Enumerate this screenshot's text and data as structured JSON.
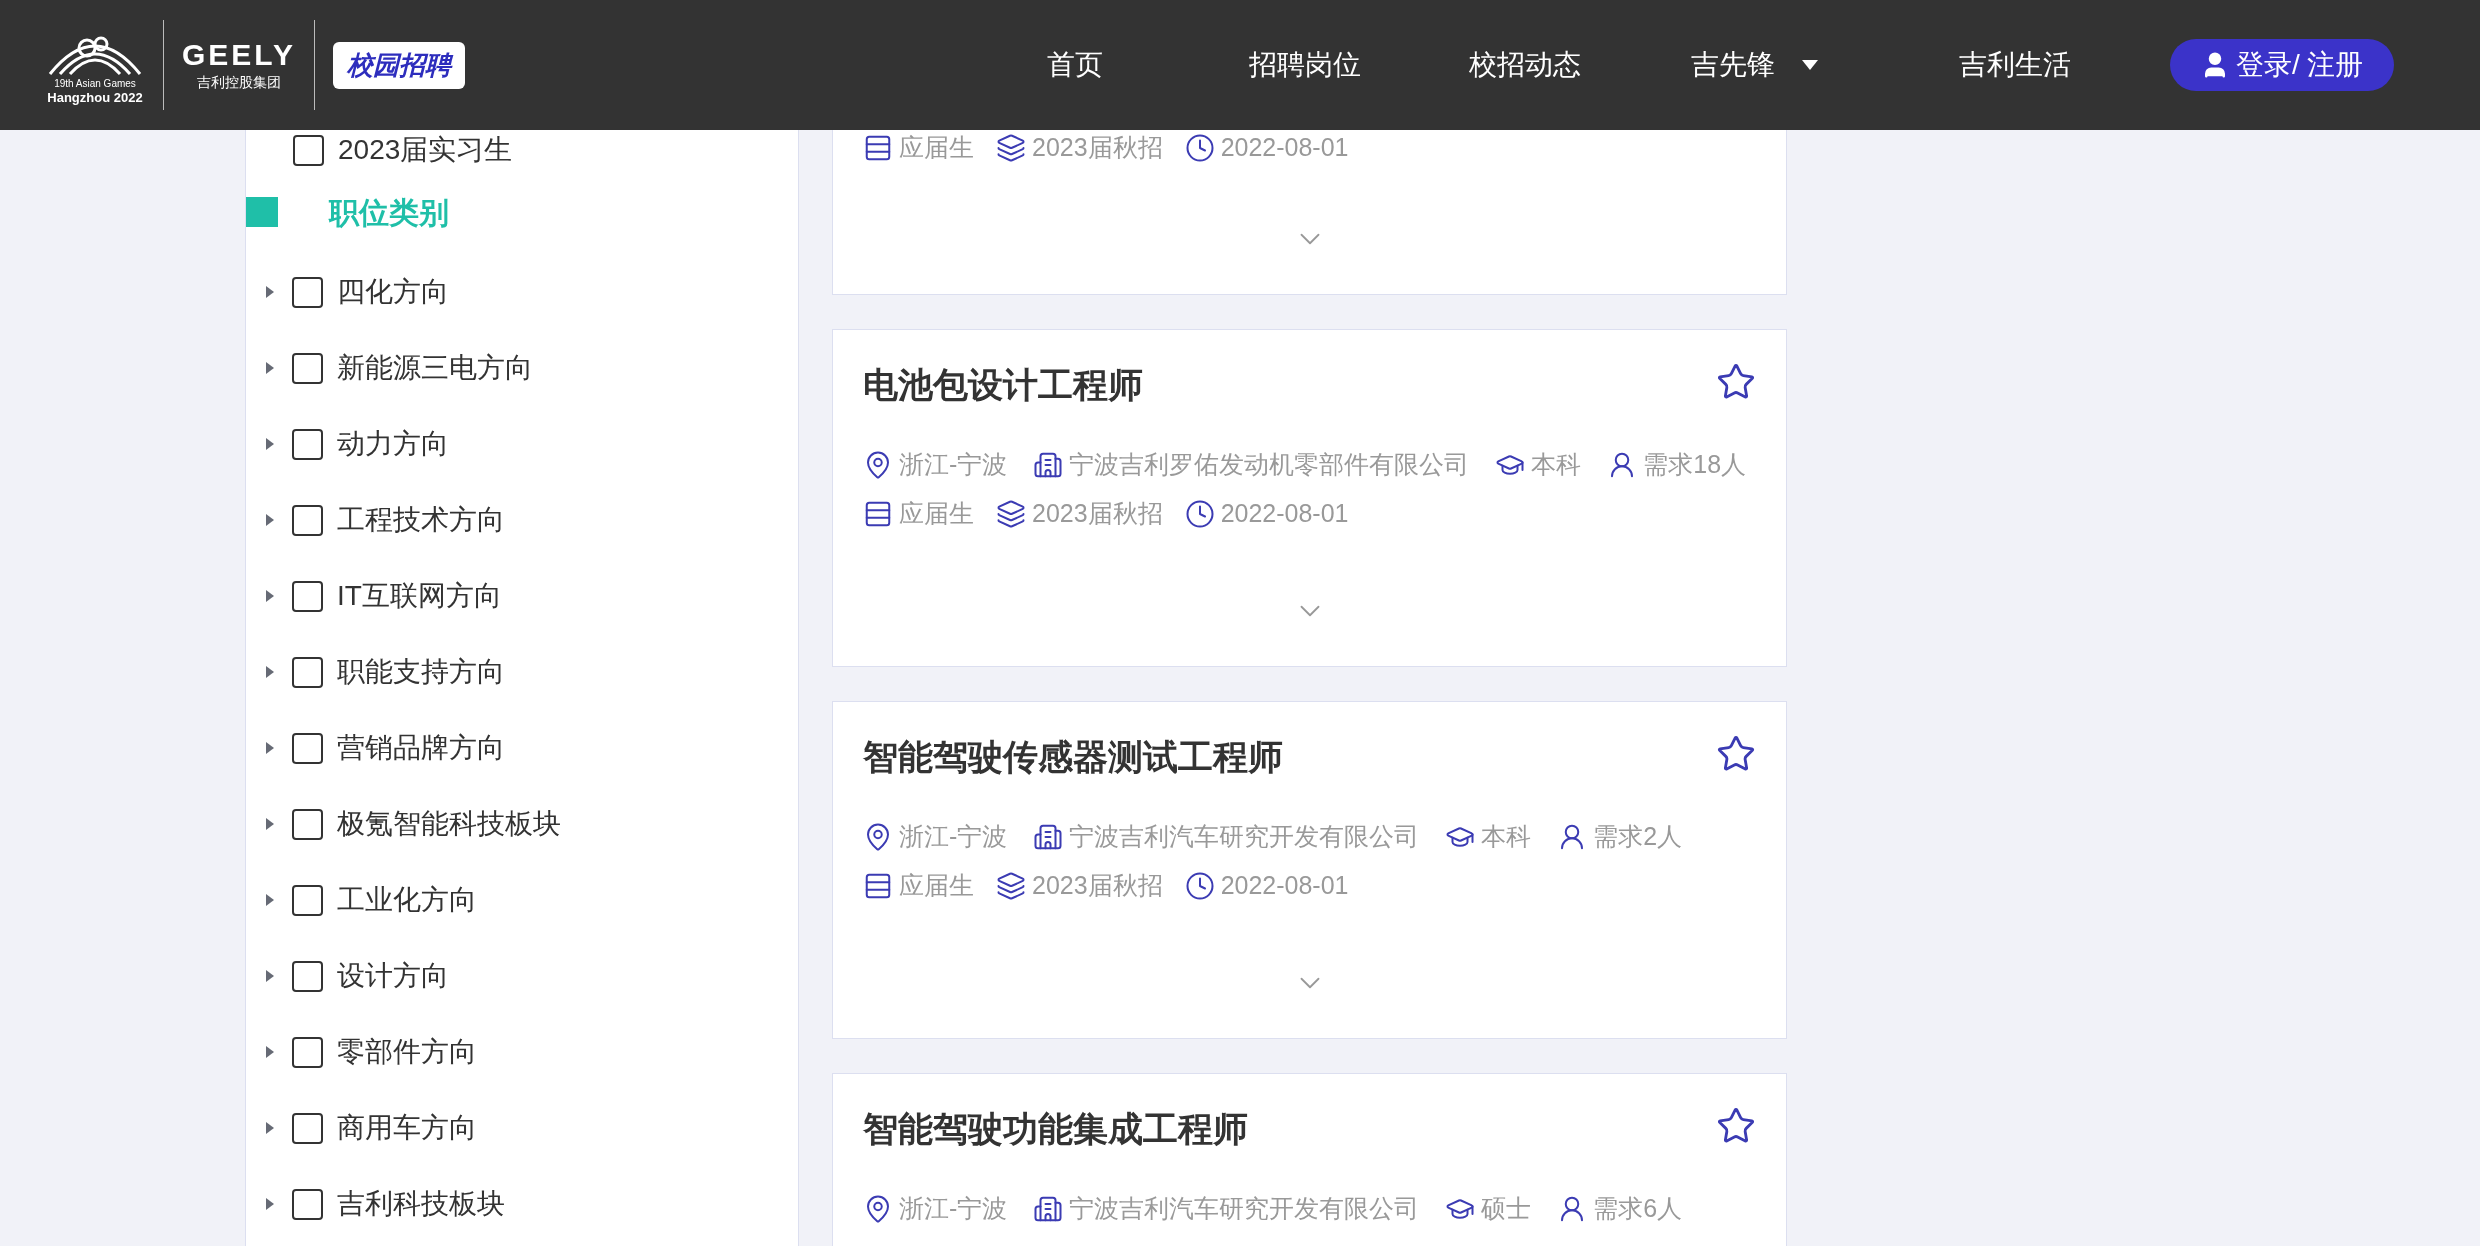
{
  "header": {
    "games_line1": "19th Asian Games",
    "games_line2": "Hangzhou 2022",
    "brand": "GEELY",
    "group": "吉利控股集团",
    "badge": "校园招聘",
    "nav": [
      {
        "label": "首页",
        "kind": "link"
      },
      {
        "label": "招聘岗位",
        "kind": "link"
      },
      {
        "label": "校招动态",
        "kind": "link"
      },
      {
        "label": "吉先锋",
        "kind": "dropdown"
      },
      {
        "label": "吉利生活",
        "kind": "link"
      }
    ],
    "login": "登录/ 注册"
  },
  "sidebar": {
    "top_rows": [
      {
        "label": "2023届实习生",
        "checked": false
      }
    ],
    "section_title": "职位类别",
    "categories": [
      {
        "label": "四化方向",
        "checked": false,
        "expanded": false
      },
      {
        "label": "新能源三电方向",
        "checked": false,
        "expanded": false
      },
      {
        "label": "动力方向",
        "checked": false,
        "expanded": false
      },
      {
        "label": "工程技术方向",
        "checked": false,
        "expanded": false
      },
      {
        "label": "IT互联网方向",
        "checked": false,
        "expanded": false
      },
      {
        "label": "职能支持方向",
        "checked": false,
        "expanded": false
      },
      {
        "label": "营销品牌方向",
        "checked": false,
        "expanded": false
      },
      {
        "label": "极氪智能科技板块",
        "checked": false,
        "expanded": false
      },
      {
        "label": "工业化方向",
        "checked": false,
        "expanded": false
      },
      {
        "label": "设计方向",
        "checked": false,
        "expanded": false
      },
      {
        "label": "零部件方向",
        "checked": false,
        "expanded": false
      },
      {
        "label": "商用车方向",
        "checked": false,
        "expanded": false
      },
      {
        "label": "吉利科技板块",
        "checked": false,
        "expanded": false
      }
    ]
  },
  "jobs": [
    {
      "type": "应届生",
      "batch": "2023届秋招",
      "date": "2022-08-01"
    },
    {
      "title": "电池包设计工程师",
      "starred": false,
      "location": "浙江-宁波",
      "company": "宁波吉利罗佑发动机零部件有限公司",
      "education": "本科",
      "headcount": "需求18人",
      "type": "应届生",
      "batch": "2023届秋招",
      "date": "2022-08-01"
    },
    {
      "title": "智能驾驶传感器测试工程师",
      "starred": false,
      "location": "浙江-宁波",
      "company": "宁波吉利汽车研究开发有限公司",
      "education": "本科",
      "headcount": "需求2人",
      "type": "应届生",
      "batch": "2023届秋招",
      "date": "2022-08-01"
    },
    {
      "title": "智能驾驶功能集成工程师",
      "starred": false,
      "location": "浙江-宁波",
      "company": "宁波吉利汽车研究开发有限公司",
      "education": "硕士",
      "headcount": "需求6人"
    }
  ]
}
